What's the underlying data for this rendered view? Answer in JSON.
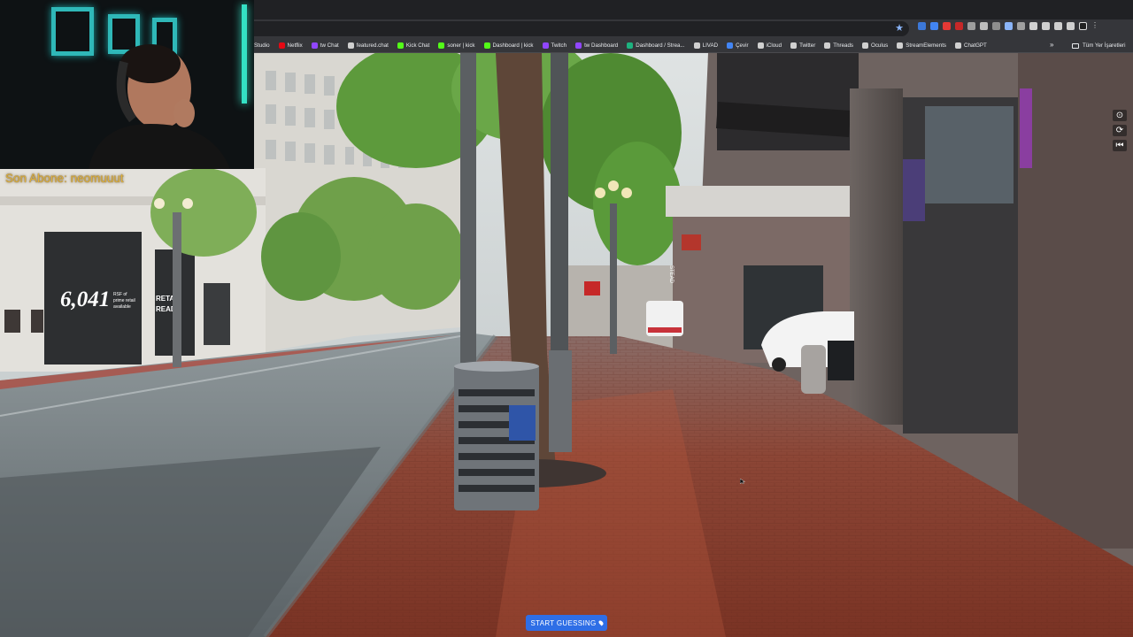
{
  "browser": {
    "bookmarks": [
      {
        "label": "Studio",
        "color": "#7a7a7a"
      },
      {
        "label": "Netflix",
        "color": "#e50914"
      },
      {
        "label": "tw Chat",
        "color": "#9146ff"
      },
      {
        "label": "featured.chat",
        "color": "#d0d0d0"
      },
      {
        "label": "Kick Chat",
        "color": "#53fc18"
      },
      {
        "label": "soner | kick",
        "color": "#53fc18"
      },
      {
        "label": "Dashboard | kick",
        "color": "#53fc18"
      },
      {
        "label": "Twitch",
        "color": "#9146ff"
      },
      {
        "label": "tw Dashboard",
        "color": "#9146ff"
      },
      {
        "label": "Dashboard / Strea...",
        "color": "#1db27f"
      },
      {
        "label": "LIVAD",
        "color": "#d0d0d0"
      },
      {
        "label": "Çevir",
        "color": "#4285f4"
      },
      {
        "label": "iCloud",
        "color": "#d0d0d0"
      },
      {
        "label": "Twitter",
        "color": "#d0d0d0"
      },
      {
        "label": "Threads",
        "color": "#d0d0d0"
      },
      {
        "label": "Oculus",
        "color": "#d0d0d0"
      },
      {
        "label": "StreamElements",
        "color": "#d0d0d0"
      },
      {
        "label": "ChatGPT",
        "color": "#d0d0d0"
      }
    ],
    "more_label": "»",
    "all_bookmarks_label": "Tüm Yer İşaretleri"
  },
  "overlay": {
    "caption": "Son Abone: neomuuut"
  },
  "game": {
    "start_button_label": "START GUESSING",
    "controls": [
      "compass",
      "refresh",
      "back-to-start"
    ]
  },
  "scene": {
    "storefront_number": "6,041",
    "storefront_small": "RSF of\nprime retail\navailable",
    "storefront_side": "RETAIL\nREADY"
  }
}
